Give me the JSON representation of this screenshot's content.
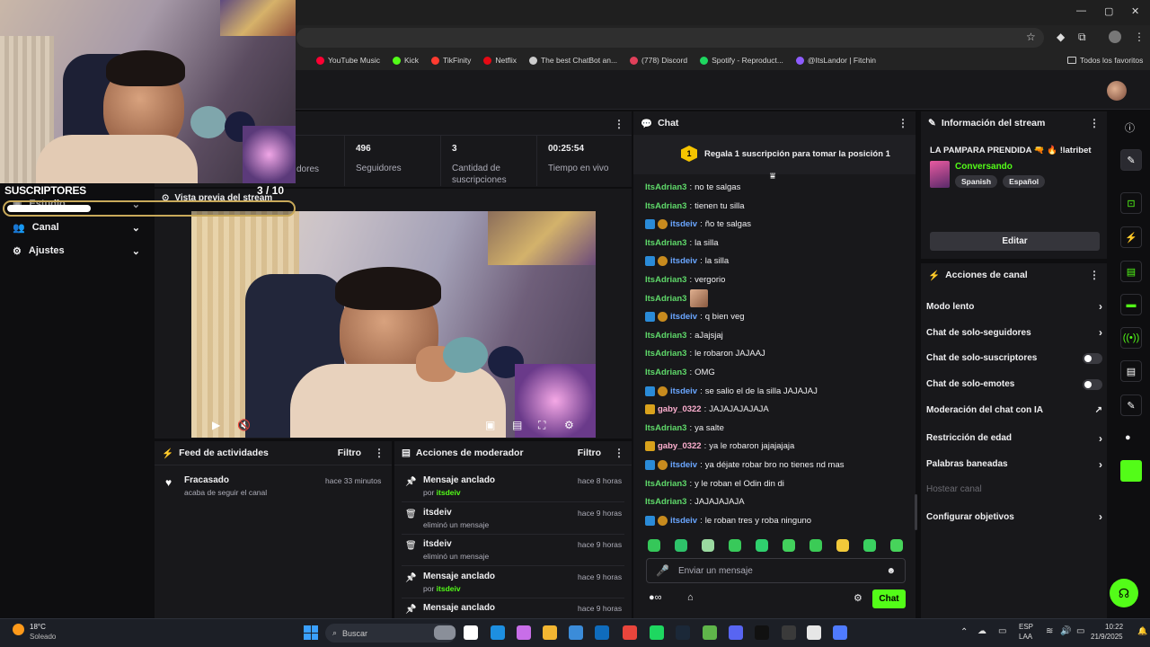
{
  "browser": {
    "bookmarks": [
      {
        "label": "YouTube Music",
        "color": "#ff0033"
      },
      {
        "label": "Kick",
        "color": "#53fc18"
      },
      {
        "label": "TikFinity",
        "color": "#ff3b30"
      },
      {
        "label": "Netflix",
        "color": "#e50914"
      },
      {
        "label": "The best ChatBot an...",
        "color": "#cccccc"
      },
      {
        "label": "(778) Discord",
        "color": "#e0405a"
      },
      {
        "label": "Spotify - Reproduct...",
        "color": "#1ed760"
      },
      {
        "label": "@ItsLandor | Fitchin",
        "color": "#8e5cff"
      }
    ],
    "all_bookmarks": "Todos los favoritos"
  },
  "overlay": {
    "subs_title": "SUSCRIPTORES",
    "subs_count": "3  / 10",
    "subs_progress": 0.3
  },
  "sidebar": {
    "items": [
      {
        "label": "Estudio",
        "icon": "studio-icon"
      },
      {
        "label": "Canal",
        "icon": "users-icon"
      },
      {
        "label": "Ajustes",
        "icon": "gear-icon"
      }
    ]
  },
  "stats": [
    {
      "value": "",
      "caption": "dores"
    },
    {
      "value": "496",
      "caption": "Seguidores"
    },
    {
      "value": "3",
      "caption": "Cantidad de suscripciones"
    },
    {
      "value": "00:25:54",
      "caption": "Tiempo en vivo"
    }
  ],
  "preview": {
    "title": "Vista previa del stream"
  },
  "feed": {
    "title": "Feed de actividades",
    "filter": "Filtro",
    "items": [
      {
        "name": "Fracasado",
        "desc": "acaba de seguir el canal",
        "time": "hace 33 minutos"
      }
    ]
  },
  "modactions": {
    "title": "Acciones de moderador",
    "filter": "Filtro",
    "items": [
      {
        "title": "Mensaje anclado",
        "sub_prefix": "por ",
        "sub_user": "itsdeiv",
        "time": "hace 8 horas",
        "icon": "pin-icon"
      },
      {
        "title": "itsdeiv",
        "sub_prefix": "eliminó un mensaje",
        "sub_user": "",
        "time": "hace 9 horas",
        "icon": "trash-icon"
      },
      {
        "title": "itsdeiv",
        "sub_prefix": "eliminó un mensaje",
        "sub_user": "",
        "time": "hace 9 horas",
        "icon": "trash-icon"
      },
      {
        "title": "Mensaje anclado",
        "sub_prefix": "por ",
        "sub_user": "itsdeiv",
        "time": "hace 9 horas",
        "icon": "pin-icon"
      },
      {
        "title": "Mensaje anclado",
        "sub_prefix": "",
        "sub_user": "",
        "time": "hace 9 horas",
        "icon": "pin-icon"
      }
    ]
  },
  "chat": {
    "title": "Chat",
    "pinned_number": "1",
    "pinned_text": "Regala 1 suscripción para tomar la posición 1",
    "messages": [
      {
        "user": "ItsAdrian3",
        "color": "green",
        "badges": [],
        "text": "no te salgas"
      },
      {
        "user": "ItsAdrian3",
        "color": "green",
        "badges": [],
        "text": "tienen tu silla"
      },
      {
        "user": "itsdeiv",
        "color": "blue",
        "badges": [
          "mod",
          "sub"
        ],
        "text": "ño te salgas"
      },
      {
        "user": "ItsAdrian3",
        "color": "green",
        "badges": [],
        "text": "la silla"
      },
      {
        "user": "itsdeiv",
        "color": "blue",
        "badges": [
          "mod",
          "sub"
        ],
        "text": "la silla"
      },
      {
        "user": "ItsAdrian3",
        "color": "green",
        "badges": [],
        "text": "vergorio"
      },
      {
        "user": "ItsAdrian3",
        "color": "green",
        "badges": [],
        "text": ""
      },
      {
        "user": "itsdeiv",
        "color": "blue",
        "badges": [
          "mod",
          "sub"
        ],
        "text": "q bien veg"
      },
      {
        "user": "ItsAdrian3",
        "color": "green",
        "badges": [],
        "text": "aJajsjaj"
      },
      {
        "user": "ItsAdrian3",
        "color": "green",
        "badges": [],
        "text": "le robaron JAJAAJ"
      },
      {
        "user": "ItsAdrian3",
        "color": "green",
        "badges": [],
        "text": "OMG"
      },
      {
        "user": "itsdeiv",
        "color": "blue",
        "badges": [
          "mod",
          "sub"
        ],
        "text": "se salio el de la silla JAJAJAJ"
      },
      {
        "user": "gaby_0322",
        "color": "pink",
        "badges": [
          "crown"
        ],
        "text": "JAJAJAJAJAJA"
      },
      {
        "user": "ItsAdrian3",
        "color": "green",
        "badges": [],
        "text": "ya salte"
      },
      {
        "user": "gaby_0322",
        "color": "pink",
        "badges": [
          "crown"
        ],
        "text": "ya le robaron jajajajaja"
      },
      {
        "user": "itsdeiv",
        "color": "blue",
        "badges": [
          "mod",
          "sub"
        ],
        "text": "ya déjate robar bro no tienes nd mas"
      },
      {
        "user": "ItsAdrian3",
        "color": "green",
        "badges": [],
        "text": "y le roban el Odin din di"
      },
      {
        "user": "ItsAdrian3",
        "color": "green",
        "badges": [],
        "text": "JAJAJAJAJA"
      },
      {
        "user": "itsdeiv",
        "color": "blue",
        "badges": [
          "mod",
          "sub"
        ],
        "text": "le roban tres y roba ninguno"
      }
    ],
    "input_placeholder": "Enviar un mensaje",
    "send_label": "Chat"
  },
  "streaminfo": {
    "title": "Información del stream",
    "stream_title": "LA PAMPARA PRENDIDA 🔫 🔥 !latribet",
    "category": "Conversando",
    "tags": [
      "Spanish",
      "Español"
    ],
    "edit_label": "Editar"
  },
  "channelactions": {
    "title": "Acciones de canal",
    "items": [
      {
        "label": "Modo lento",
        "control": "chevron"
      },
      {
        "label": "Chat de solo-seguidores",
        "control": "chevron"
      },
      {
        "label": "Chat de solo-suscriptores",
        "control": "toggle"
      },
      {
        "label": "Chat de solo-emotes",
        "control": "toggle"
      },
      {
        "label": "Moderación del chat con IA",
        "control": "external"
      },
      {
        "label": "Restricción de edad",
        "control": "chevron"
      },
      {
        "label": "Palabras baneadas",
        "control": "chevron"
      },
      {
        "label": "Hostear canal",
        "control": "none"
      },
      {
        "label": "Configurar objetivos",
        "control": "chevron"
      }
    ]
  },
  "taskbar": {
    "weather_temp": "18°C",
    "weather_desc": "Soleado",
    "search_placeholder": "Buscar",
    "lang1": "ESP",
    "lang2": "LAA",
    "time": "10:22",
    "date": "21/9/2025"
  },
  "colors": {
    "accent": "#53fc18",
    "panel": "#18181b",
    "bg": "#0e0e10"
  }
}
